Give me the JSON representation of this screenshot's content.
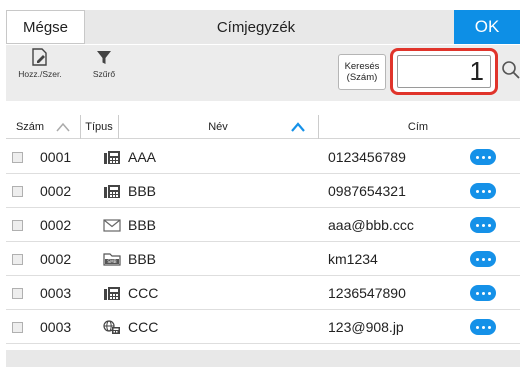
{
  "header": {
    "cancel_label": "Mégse",
    "title": "Címjegyzék",
    "ok_label": "OK"
  },
  "toolbar": {
    "add_edit_label": "Hozz./Szer.",
    "filter_label": "Szűrő",
    "search_type_label": "Keresés\n(Szám)",
    "search_value": "1"
  },
  "columns": {
    "number": "Szám",
    "type": "Típus",
    "name": "Név",
    "address": "Cím"
  },
  "rows": [
    {
      "number": "0001",
      "type_icon": "fax-icon",
      "name": "AAA",
      "address": "0123456789"
    },
    {
      "number": "0002",
      "type_icon": "fax-icon",
      "name": "BBB",
      "address": "0987654321"
    },
    {
      "number": "0002",
      "type_icon": "email-icon",
      "name": "BBB",
      "address": "aaa@bbb.ccc"
    },
    {
      "number": "0002",
      "type_icon": "smb-icon",
      "name": "BBB",
      "address": "km1234"
    },
    {
      "number": "0003",
      "type_icon": "fax-icon",
      "name": "CCC",
      "address": "1236547890"
    },
    {
      "number": "0003",
      "type_icon": "ifax-icon",
      "name": "CCC",
      "address": "123@908.jp"
    }
  ],
  "colors": {
    "accent": "#0d8fe6",
    "highlight": "#e0342b",
    "details_button": "#1591e8"
  }
}
